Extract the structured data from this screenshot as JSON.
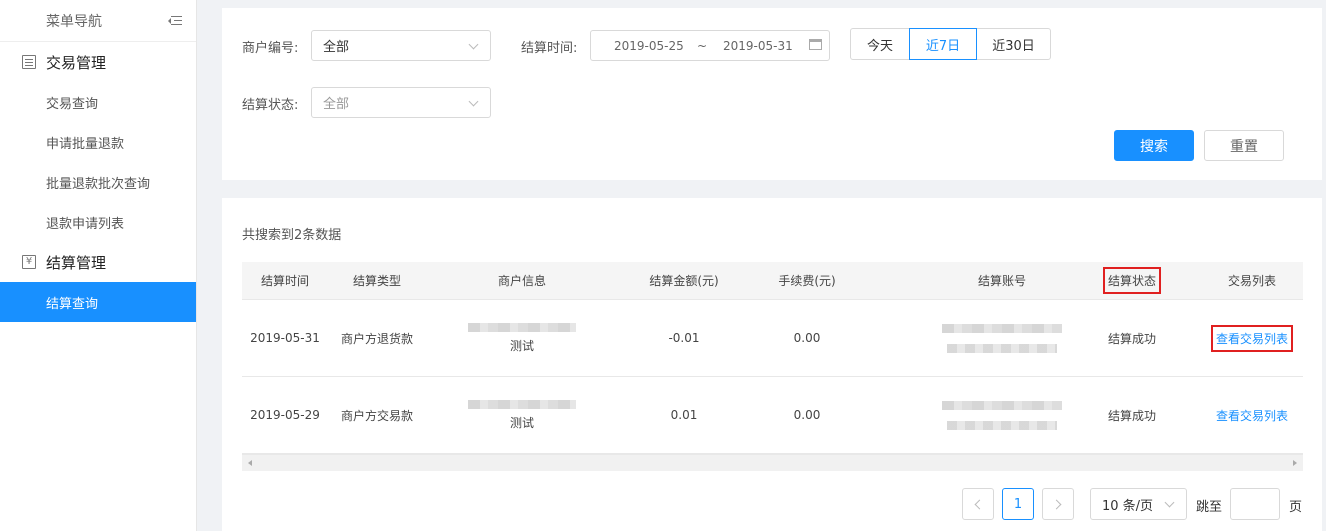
{
  "sidebar": {
    "title": "菜单导航",
    "groups": [
      {
        "label": "交易管理",
        "icon": "document-icon",
        "items": [
          "交易查询",
          "申请批量退款",
          "批量退款批次查询",
          "退款申请列表"
        ]
      },
      {
        "label": "结算管理",
        "icon": "yen-icon",
        "items": [
          "结算查询"
        ]
      }
    ],
    "active_item": "结算查询"
  },
  "filters": {
    "merchant_label": "商户编号:",
    "merchant_value": "全部",
    "settle_time_label": "结算时间:",
    "date_start": "2019-05-25",
    "date_sep": "~",
    "date_end": "2019-05-31",
    "quick_ranges": [
      "今天",
      "近7日",
      "近30日"
    ],
    "quick_active": "近7日",
    "status_label": "结算状态:",
    "status_value": "全部",
    "search_button": "搜索",
    "reset_button": "重置"
  },
  "results": {
    "count_text": "共搜索到2条数据",
    "columns": [
      "结算时间",
      "结算类型",
      "商户信息",
      "结算金额(元)",
      "手续费(元)",
      "结算账号",
      "结算状态",
      "交易列表"
    ],
    "rows": [
      {
        "time": "2019-05-31",
        "type": "商户方退货款",
        "merchant_note": "测试",
        "amount": "-0.01",
        "fee": "0.00",
        "status": "结算成功",
        "link": "查看交易列表"
      },
      {
        "time": "2019-05-29",
        "type": "商户方交易款",
        "merchant_note": "测试",
        "amount": "0.01",
        "fee": "0.00",
        "status": "结算成功",
        "link": "查看交易列表"
      }
    ]
  },
  "pagination": {
    "current_page": "1",
    "page_size": "10 条/页",
    "jump_label": "跳至",
    "page_unit": "页"
  },
  "colors": {
    "primary": "#1890ff",
    "highlight_box": "#e02020"
  }
}
